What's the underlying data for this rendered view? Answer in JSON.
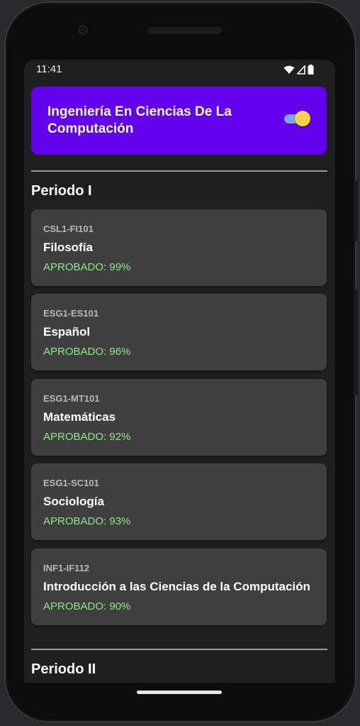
{
  "status_bar": {
    "time": "11:41"
  },
  "header": {
    "title": "Ingeniería En Ciencias De La Computación",
    "toggle_on": true
  },
  "periods": [
    {
      "title": "Periodo I",
      "courses": [
        {
          "code": "CSL1-FI101",
          "name": "Filosofía",
          "status": "APROBADO: 99%"
        },
        {
          "code": "ESG1-ES101",
          "name": "Español",
          "status": "APROBADO: 96%"
        },
        {
          "code": "ESG1-MT101",
          "name": "Matemáticas",
          "status": "APROBADO: 92%"
        },
        {
          "code": "ESG1-SC101",
          "name": "Sociología",
          "status": "APROBADO: 93%"
        },
        {
          "code": "INF1-IF112",
          "name": "Introducción a las Ciencias de la Computación",
          "status": "APROBADO: 90%"
        }
      ]
    },
    {
      "title": "Periodo II",
      "courses": []
    }
  ],
  "colors": {
    "header_bg": "#6200ee",
    "card_bg": "#3f3f3f",
    "status_green": "#8ee88a",
    "toggle_thumb": "#f5d547",
    "toggle_track": "#7aa8e8"
  },
  "icons": {
    "wifi": "wifi-icon",
    "signal": "cell-signal-icon",
    "battery": "battery-icon"
  }
}
